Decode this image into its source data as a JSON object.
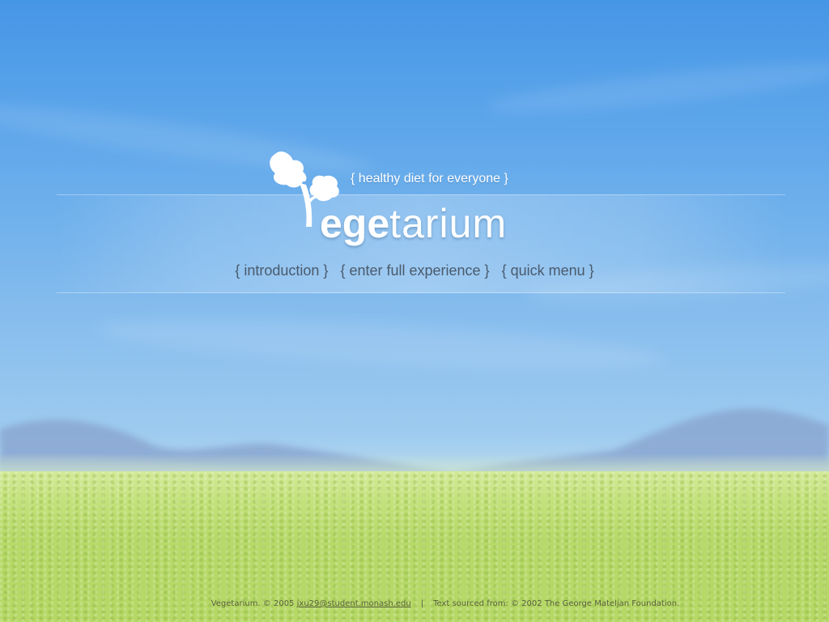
{
  "site": {
    "tagline": "{ healthy diet for everyone }",
    "wordmark_bold": "ege",
    "wordmark_light": "tarium"
  },
  "nav": {
    "items": [
      {
        "label": "{ introduction }"
      },
      {
        "label": "{ enter full experience }"
      },
      {
        "label": "{ quick menu }"
      }
    ]
  },
  "footer": {
    "copyright_prefix": "Vegetarium. © 2005",
    "email": "jxu29@student.monash.edu",
    "separator": "|",
    "source_text": "Text sourced from: © 2002 The George Mateljan Foundation."
  },
  "icons": {
    "logo": "leaf-sprout-logo-icon"
  },
  "colors": {
    "sky_top": "#4696e6",
    "sky_bottom": "#b7d9ee",
    "grass": "#b7d96a",
    "nav_text": "#4a5a6c",
    "footer_text": "#55603a"
  }
}
